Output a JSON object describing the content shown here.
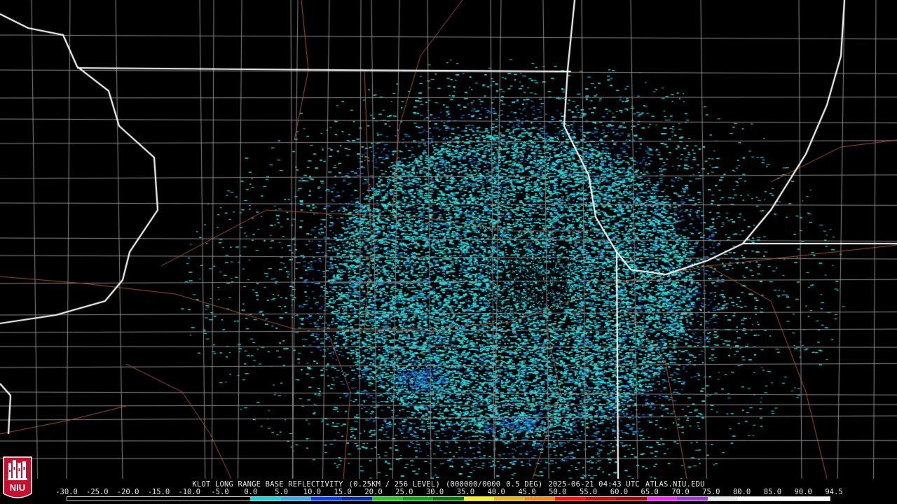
{
  "product": {
    "radar_site": "KLOT",
    "title": "KLOT LONG RANGE BASE REFLECTIVITY",
    "resolution": "(0.25KM / 256 LEVEL)",
    "scan_id": "(000000/0000",
    "elevation": "0.5 DEG)",
    "timestamp": "2025-06-21 04:43 UTC",
    "source": "ATLAS.NIU.EDU"
  },
  "colorbar": {
    "ticks": [
      "-30.0",
      "-25.0",
      "-20.0",
      "-15.0",
      "-10.0",
      "-5.0",
      "0.0",
      "5.0",
      "10.0",
      "15.0",
      "20.0",
      "25.0",
      "30.0",
      "35.0",
      "40.0",
      "45.0",
      "50.0",
      "55.0",
      "60.0",
      "65.0",
      "70.0",
      "75.0",
      "80.0",
      "85.0",
      "90.0",
      "94.5"
    ],
    "colors": [
      "#000000",
      "#000000",
      "#000000",
      "#000000",
      "#000000",
      "#000000",
      "#1fd3d3",
      "#3aa7e7",
      "#0c3fe8",
      "#0a2aa0",
      "#27c91a",
      "#0fa40f",
      "#0a760a",
      "#f6f21a",
      "#e8b812",
      "#f08c14",
      "#f31414",
      "#c21010",
      "#9c0c0c",
      "#f02ef0",
      "#9e3ccf",
      "#e8e8e8",
      "#ffffff",
      "#ffffff",
      "#ffffff"
    ]
  },
  "map_colors": {
    "state_border": "#ffffff",
    "county_border": "#8a8a8a",
    "road": "#a5552c",
    "echo_primary": "#2fdcdc",
    "echo_secondary": "#1f74e0"
  },
  "logo": {
    "label": "NIU",
    "icon": "niu-castle-logo",
    "color": "#c8102e"
  }
}
